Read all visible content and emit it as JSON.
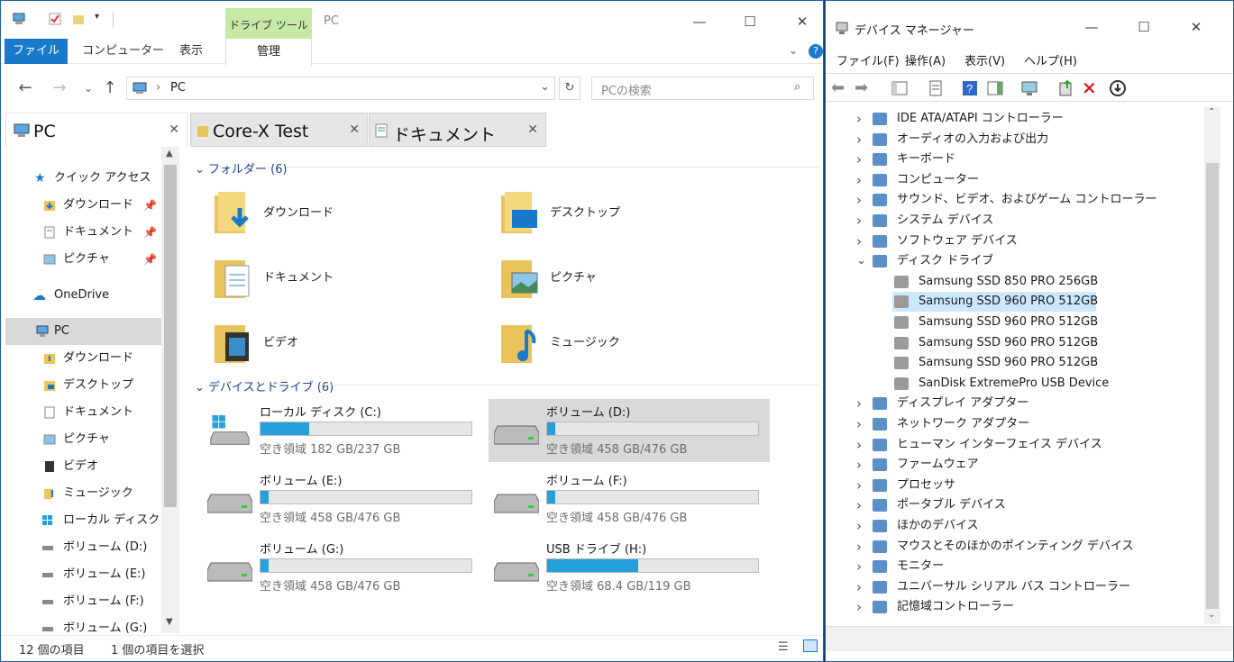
{
  "explorer": {
    "title": "PC",
    "drive_tools_label": "ドライブ ツール",
    "ribbon": {
      "file": "ファイル",
      "computer": "コンピューター",
      "view": "表示",
      "manage": "管理"
    },
    "address_text": "PC",
    "search_placeholder": "PCの検索",
    "tabs": [
      {
        "label": "PC"
      },
      {
        "label": "Core-X Test"
      },
      {
        "label": "ドキュメント"
      }
    ],
    "nav": {
      "quick_access": "クイック アクセス",
      "quick_items": [
        "ダウンロード",
        "ドキュメント",
        "ピクチャ"
      ],
      "onedrive": "OneDrive",
      "pc": "PC",
      "pc_items": [
        "ダウンロード",
        "デスクトップ",
        "ドキュメント",
        "ピクチャ",
        "ビデオ",
        "ミュージック",
        "ローカル ディスク (C",
        "ボリューム (D:)",
        "ボリューム (E:)",
        "ボリューム (F:)",
        "ボリューム (G:)"
      ]
    },
    "folders_header": "フォルダー (6)",
    "folders": [
      "ダウンロード",
      "デスクトップ",
      "ドキュメント",
      "ピクチャ",
      "ビデオ",
      "ミュージック"
    ],
    "drives_header": "デバイスとドライブ (6)",
    "drives": [
      {
        "name": "ローカル ディスク (C:)",
        "free": "空き領域 182 GB/237 GB",
        "used_fraction": 0.23
      },
      {
        "name": "ボリューム (D:)",
        "free": "空き領域 458 GB/476 GB",
        "used_fraction": 0.04
      },
      {
        "name": "ボリューム (E:)",
        "free": "空き領域 458 GB/476 GB",
        "used_fraction": 0.04
      },
      {
        "name": "ボリューム (F:)",
        "free": "空き領域 458 GB/476 GB",
        "used_fraction": 0.04
      },
      {
        "name": "ボリューム (G:)",
        "free": "空き領域 458 GB/476 GB",
        "used_fraction": 0.04
      },
      {
        "name": "USB ドライブ (H:)",
        "free": "空き領域 68.4 GB/119 GB",
        "used_fraction": 0.43
      }
    ],
    "status": {
      "count": "12 個の項目",
      "selected": "1 個の項目を選択"
    },
    "accent": "#1979ca"
  },
  "devmgr": {
    "title": "デバイス マネージャー",
    "menu": [
      "ファイル(F)",
      "操作(A)",
      "表示(V)",
      "ヘルプ(H)"
    ],
    "tree": [
      {
        "label": "IDE ATA/ATAPI コントローラー",
        "level": 0,
        "expanded": false
      },
      {
        "label": "オーディオの入力および出力",
        "level": 0,
        "expanded": false
      },
      {
        "label": "キーボード",
        "level": 0,
        "expanded": false
      },
      {
        "label": "コンピューター",
        "level": 0,
        "expanded": false
      },
      {
        "label": "サウンド、ビデオ、およびゲーム コントローラー",
        "level": 0,
        "expanded": false
      },
      {
        "label": "システム デバイス",
        "level": 0,
        "expanded": false
      },
      {
        "label": "ソフトウェア デバイス",
        "level": 0,
        "expanded": false
      },
      {
        "label": "ディスク ドライブ",
        "level": 0,
        "expanded": true
      },
      {
        "label": "Samsung SSD 850 PRO 256GB",
        "level": 1
      },
      {
        "label": "Samsung SSD 960 PRO 512GB",
        "level": 1,
        "selected": true
      },
      {
        "label": "Samsung SSD 960 PRO 512GB",
        "level": 1
      },
      {
        "label": "Samsung SSD 960 PRO 512GB",
        "level": 1
      },
      {
        "label": "Samsung SSD 960 PRO 512GB",
        "level": 1
      },
      {
        "label": "SanDisk ExtremePro USB Device",
        "level": 1
      },
      {
        "label": "ディスプレイ アダプター",
        "level": 0,
        "expanded": false
      },
      {
        "label": "ネットワーク アダプター",
        "level": 0,
        "expanded": false
      },
      {
        "label": "ヒューマン インターフェイス デバイス",
        "level": 0,
        "expanded": false
      },
      {
        "label": "ファームウェア",
        "level": 0,
        "expanded": false
      },
      {
        "label": "プロセッサ",
        "level": 0,
        "expanded": false
      },
      {
        "label": "ポータブル デバイス",
        "level": 0,
        "expanded": false
      },
      {
        "label": "ほかのデバイス",
        "level": 0,
        "expanded": false
      },
      {
        "label": "マウスとそのほかのポインティング デバイス",
        "level": 0,
        "expanded": false
      },
      {
        "label": "モニター",
        "level": 0,
        "expanded": false
      },
      {
        "label": "ユニバーサル シリアル バス コントローラー",
        "level": 0,
        "expanded": false
      },
      {
        "label": "記憶域コントローラー",
        "level": 0,
        "expanded": false
      }
    ]
  }
}
